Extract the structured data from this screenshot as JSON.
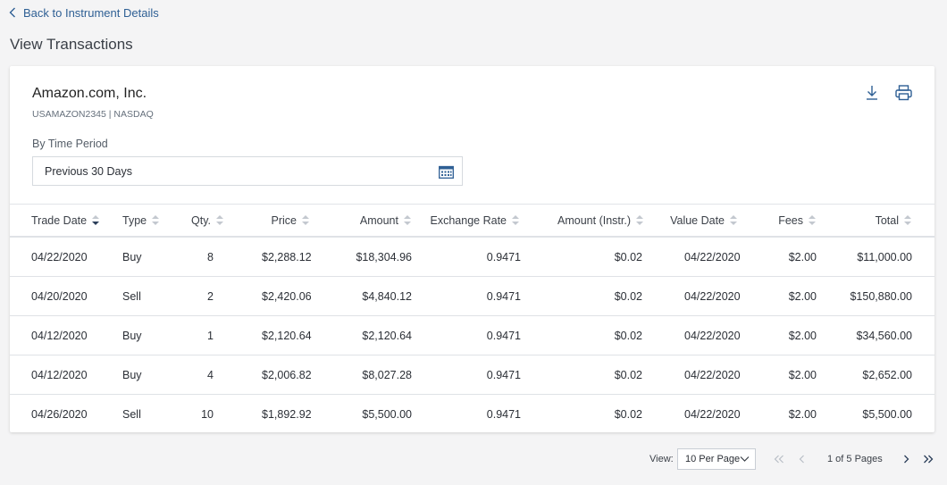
{
  "nav": {
    "back_label": "Back to Instrument Details"
  },
  "page": {
    "title": "View Transactions"
  },
  "instrument": {
    "name": "Amazon.com, Inc.",
    "subtitle": "USAMAZON2345 | NASDAQ"
  },
  "filter": {
    "label": "By Time Period",
    "value": "Previous 30 Days"
  },
  "icons": {
    "back": "chevron-left-icon",
    "download": "download-icon",
    "print": "print-icon",
    "calendar": "calendar-icon"
  },
  "colors": {
    "accent": "#2e5f94",
    "sort_active": "#2b3e59"
  },
  "table": {
    "columns": [
      {
        "label": "Trade Date",
        "sort": "desc"
      },
      {
        "label": "Type",
        "sort": "none"
      },
      {
        "label": "Qty.",
        "sort": "none"
      },
      {
        "label": "Price",
        "sort": "none"
      },
      {
        "label": "Amount",
        "sort": "none"
      },
      {
        "label": "Exchange Rate",
        "sort": "none"
      },
      {
        "label": "Amount (Instr.)",
        "sort": "none"
      },
      {
        "label": "Value Date",
        "sort": "none"
      },
      {
        "label": "Fees",
        "sort": "none"
      },
      {
        "label": "Total",
        "sort": "none"
      }
    ],
    "rows": [
      [
        "04/22/2020",
        "Buy",
        "8",
        "$2,288.12",
        "$18,304.96",
        "0.9471",
        "$0.02",
        "04/22/2020",
        "$2.00",
        "$11,000.00"
      ],
      [
        "04/20/2020",
        "Sell",
        "2",
        "$2,420.06",
        "$4,840.12",
        "0.9471",
        "$0.02",
        "04/22/2020",
        "$2.00",
        "$150,880.00"
      ],
      [
        "04/12/2020",
        "Buy",
        "1",
        "$2,120.64",
        "$2,120.64",
        "0.9471",
        "$0.02",
        "04/22/2020",
        "$2.00",
        "$34,560.00"
      ],
      [
        "04/12/2020",
        "Buy",
        "4",
        "$2,006.82",
        "$8,027.28",
        "0.9471",
        "$0.02",
        "04/22/2020",
        "$2.00",
        "$2,652.00"
      ],
      [
        "04/26/2020",
        "Sell",
        "10",
        "$1,892.92",
        "$5,500.00",
        "0.9471",
        "$0.02",
        "04/22/2020",
        "$2.00",
        "$5,500.00"
      ]
    ]
  },
  "pagination": {
    "view_label": "View:",
    "per_page": "10 Per Page",
    "page_text": "1 of 5 Pages"
  }
}
